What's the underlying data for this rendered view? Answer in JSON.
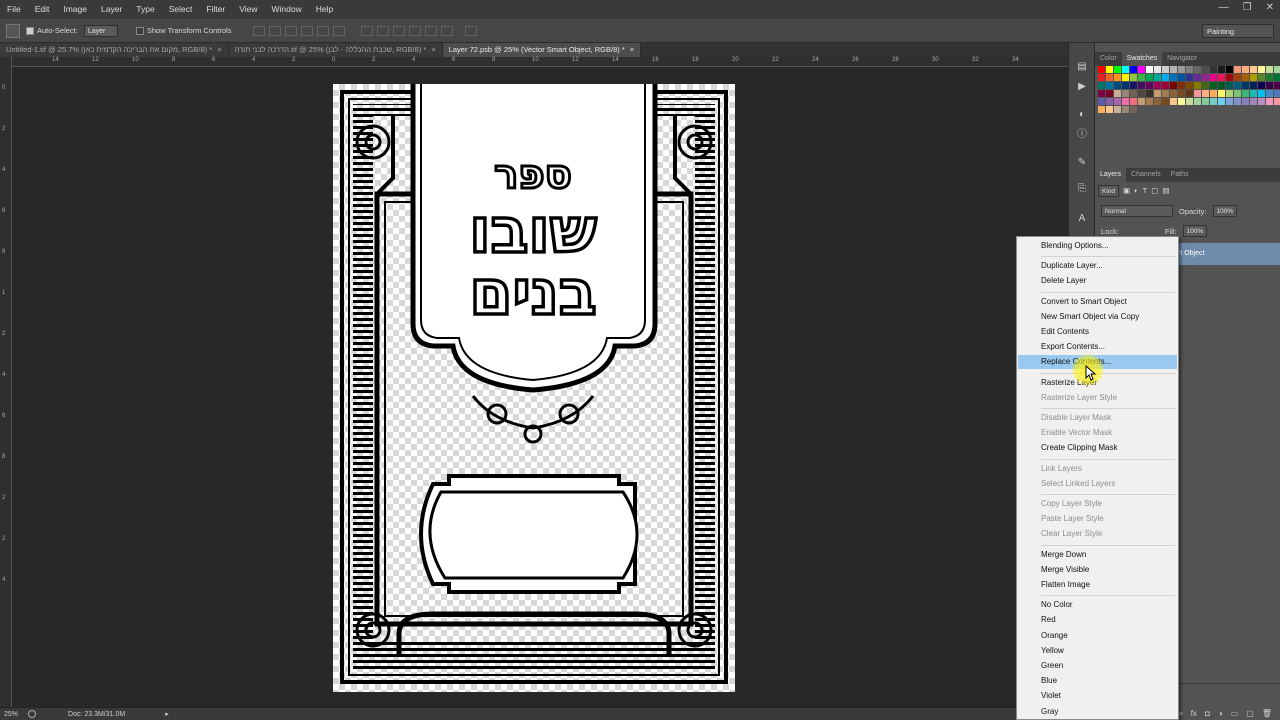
{
  "menubar": {
    "items": [
      "File",
      "Edit",
      "Image",
      "Layer",
      "Type",
      "Select",
      "Filter",
      "View",
      "Window",
      "Help"
    ]
  },
  "window_controls": [
    "—",
    "❐",
    "✕"
  ],
  "options": {
    "auto_select_label": "Auto-Select:",
    "auto_select_value": "Layer",
    "transform_label": "Show Transform Controls"
  },
  "workspace": "Painting",
  "tabs": [
    "Untitled-1.tif @ 25.7% (מקום את הבריכה הקדמית כאן, RGB/8) *",
    "הדרכה לבני תורה.tif @ 25% (שכבת ההכללה - לבן, RGB/8) *",
    "Layer 72.psb @ 25% (Vector Smart Object, RGB/8) *"
  ],
  "ruler_top": [
    "14",
    "12",
    "10",
    "8",
    "6",
    "4",
    "2",
    "0",
    "2",
    "4",
    "6",
    "8",
    "10",
    "12",
    "14",
    "16",
    "18",
    "20",
    "22",
    "24",
    "26",
    "28",
    "30",
    "32",
    "34"
  ],
  "ruler_left": [
    "0",
    "2",
    "4",
    "6",
    "8",
    "1",
    "2",
    "4",
    "6",
    "8",
    "2",
    "2",
    "4"
  ],
  "document": {
    "title_line1": "ספר",
    "title_line2": "שובו",
    "title_line3": "בנים"
  },
  "status": {
    "zoom": "25%",
    "doc": "Doc: 23.3M/31.0M"
  },
  "panels": {
    "top_tabs": [
      "Color",
      "Swatches",
      "Navigator"
    ],
    "layer_tabs": [
      "Layers",
      "Channels",
      "Paths"
    ],
    "kind": "Kind",
    "blend_mode": "Normal",
    "opacity_label": "Opacity:",
    "opacity_value": "100%",
    "lock_label": "Lock:",
    "fill_label": "Fill:",
    "fill_value": "100%",
    "layer_name_tail": "rt Object"
  },
  "swatch_colors": [
    "#ff0000",
    "#ffff00",
    "#00ff00",
    "#00ffff",
    "#0000ff",
    "#ff00ff",
    "#ffffff",
    "#e6e6e6",
    "#cccccc",
    "#b3b3b3",
    "#999999",
    "#808080",
    "#666666",
    "#4d4d4d",
    "#333333",
    "#1a1a1a",
    "#000000",
    "#f7977a",
    "#f9ad81",
    "#fdc68a",
    "#fff79a",
    "#c4df9b",
    "#a2d39c",
    "#ed1c24",
    "#f26522",
    "#f7941d",
    "#fff200",
    "#8dc63f",
    "#39b54a",
    "#00a651",
    "#00a99d",
    "#00aeef",
    "#0072bc",
    "#0054a6",
    "#2e3192",
    "#662d91",
    "#92278f",
    "#ec008c",
    "#ed145b",
    "#9e0b0f",
    "#a0410d",
    "#a3620a",
    "#aba000",
    "#598527",
    "#1a7b30",
    "#007236",
    "#00746b",
    "#0076a3",
    "#004a80",
    "#003471",
    "#1b1464",
    "#440e62",
    "#630460",
    "#9e005d",
    "#9e0039",
    "#790000",
    "#7b2e00",
    "#7d4900",
    "#827b00",
    "#406618",
    "#005e20",
    "#005826",
    "#005952",
    "#005b7f",
    "#003663",
    "#002157",
    "#0d004c",
    "#32004b",
    "#4b0049",
    "#7b0046",
    "#7a0026",
    "#c7b299",
    "#998675",
    "#736357",
    "#534741",
    "#37302a",
    "#c69c6d",
    "#a67c52",
    "#8c6239",
    "#754c24",
    "#603913",
    "#f5989d",
    "#f9ad81",
    "#fbaf5d",
    "#fff568",
    "#acd373",
    "#7cc576",
    "#3bb878",
    "#1abbb4",
    "#00bff3",
    "#438ccb",
    "#5574b9",
    "#605ca8",
    "#8560a8",
    "#a864a8",
    "#f06eaa",
    "#f26d7d",
    "#c69c6d",
    "#a67c52",
    "#8c6239",
    "#754c24",
    "#fdc68a",
    "#fff79a",
    "#c4df9b",
    "#a2d39c",
    "#82ca9c",
    "#7accc8",
    "#6dcff6",
    "#7da7d9",
    "#8393ca",
    "#8781bd",
    "#a187be",
    "#bc8dbf",
    "#f49ac2",
    "#f6989d",
    "#fbaf5d",
    "#fdc68a",
    "#c7b299",
    "#998675",
    "#736357"
  ],
  "context_menu": [
    {
      "label": "Blending Options...",
      "state": "enabled"
    },
    {
      "label": "Duplicate Layer...",
      "state": "enabled"
    },
    {
      "label": "Delete Layer",
      "state": "enabled"
    },
    {
      "label": "Convert to Smart Object",
      "state": "enabled"
    },
    {
      "label": "New Smart Object via Copy",
      "state": "enabled"
    },
    {
      "label": "Edit Contents",
      "state": "enabled"
    },
    {
      "label": "Export Contents...",
      "state": "enabled"
    },
    {
      "label": "Replace Contents...",
      "state": "highlighted"
    },
    {
      "label": "Rasterize Layer",
      "state": "enabled"
    },
    {
      "label": "Rasterize Layer Style",
      "state": "disabled"
    },
    {
      "label": "Disable Layer Mask",
      "state": "disabled"
    },
    {
      "label": "Enable Vector Mask",
      "state": "disabled"
    },
    {
      "label": "Create Clipping Mask",
      "state": "enabled"
    },
    {
      "label": "Link Layers",
      "state": "disabled"
    },
    {
      "label": "Select Linked Layers",
      "state": "disabled"
    },
    {
      "label": "Copy Layer Style",
      "state": "disabled"
    },
    {
      "label": "Paste Layer Style",
      "state": "disabled"
    },
    {
      "label": "Clear Layer Style",
      "state": "disabled"
    },
    {
      "label": "Merge Down",
      "state": "enabled"
    },
    {
      "label": "Merge Visible",
      "state": "enabled"
    },
    {
      "label": "Flatten Image",
      "state": "enabled"
    },
    {
      "label": "No Color",
      "state": "enabled"
    },
    {
      "label": "Red",
      "state": "enabled"
    },
    {
      "label": "Orange",
      "state": "enabled"
    },
    {
      "label": "Yellow",
      "state": "enabled"
    },
    {
      "label": "Green",
      "state": "enabled"
    },
    {
      "label": "Blue",
      "state": "enabled"
    },
    {
      "label": "Violet",
      "state": "enabled"
    },
    {
      "label": "Gray",
      "state": "enabled"
    }
  ],
  "colors": {
    "menu_highlight": "#99c9ef",
    "layer_selected": "#6f8bab",
    "cursor_halo": "#fff000"
  }
}
